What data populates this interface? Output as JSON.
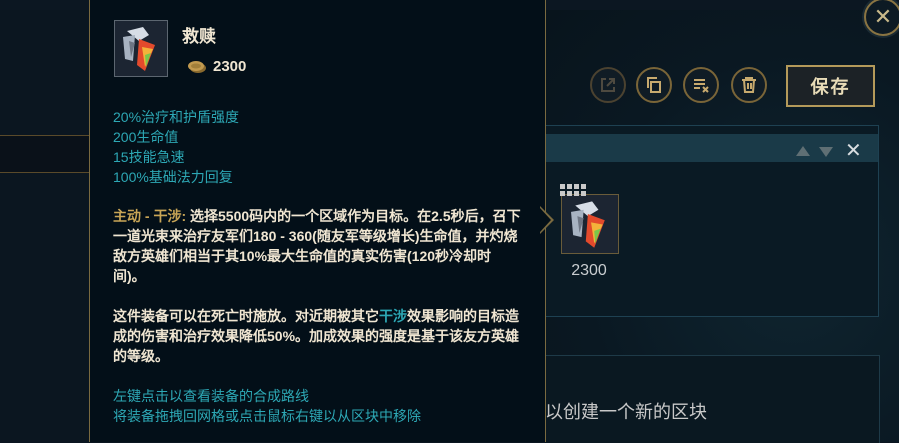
{
  "window": {
    "close_icon": "close-icon"
  },
  "toolbar": {
    "buttons": [
      {
        "icon": "external-link-icon",
        "state": "disabled"
      },
      {
        "icon": "copy-icon",
        "state": "enabled"
      },
      {
        "icon": "clear-list-icon",
        "state": "enabled"
      },
      {
        "icon": "trash-icon",
        "state": "enabled"
      }
    ],
    "save_label": "保存"
  },
  "tooltip": {
    "item_name": "救赎",
    "price": "2300",
    "stats": [
      "20%治疗和护盾强度",
      "200生命值",
      "15技能急速",
      "100%基础法力回复"
    ],
    "active_label": "主动 - 干涉:",
    "active_text": " 选择5500码内的一个区域作为目标。在2.5秒后，召下一道光束来治疗友军们180 - 360(随友军等级增长)生命值，并灼烧敌方英雄们相当于其10%最大生命值的真实伤害(120秒冷却时间)。",
    "passive_part1": "这件装备可以在死亡时施放。对近期被其它",
    "passive_keyword": "干涉",
    "passive_part2": "效果影响的目标造成的伤害和治疗效果降低50%。加成效果的强度是基于该友方英雄的等级。",
    "hints": [
      "左键点击以查看装备的合成路线",
      "将装备拖拽回网格或点击鼠标右键以从区块中移除"
    ]
  },
  "block": {
    "item_price": "2300",
    "new_block_text": "以创建一个新的区块"
  },
  "colors": {
    "accent_gold": "#c8aa6e",
    "stat_cyan": "#2da8b5",
    "text_light": "#f0e6d2"
  }
}
